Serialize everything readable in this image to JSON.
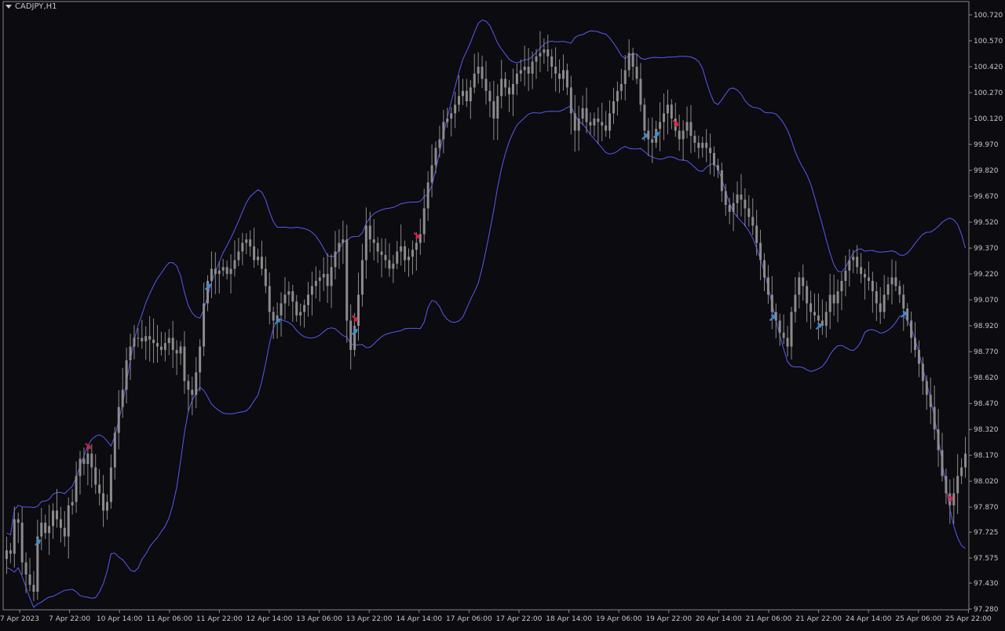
{
  "window": {
    "symbol": "CADJPY,H1"
  },
  "colors": {
    "background": "#0b0b10",
    "axis": "#8a8a8a",
    "text": "#c8c8c8",
    "candle": "#8c8c8c",
    "bands": "#5a5af0",
    "buy_arrow": "#3c8ccf",
    "sell_arrow": "#e01b3c"
  },
  "chart_data": {
    "type": "candlestick",
    "title": "CADJPY,H1",
    "ylim": [
      97.28,
      100.77
    ],
    "y_ticks": [
      "100.720",
      "100.570",
      "100.420",
      "100.270",
      "100.120",
      "99.970",
      "99.820",
      "99.670",
      "99.520",
      "99.370",
      "99.220",
      "99.070",
      "98.920",
      "98.770",
      "98.620",
      "98.470",
      "98.320",
      "98.170",
      "98.020",
      "97.870",
      "97.725",
      "97.575",
      "97.430",
      "97.280"
    ],
    "x_ticks": [
      "7 Apr 2023",
      "7 Apr 22:00",
      "10 Apr 14:00",
      "11 Apr 06:00",
      "11 Apr 22:00",
      "12 Apr 14:00",
      "13 Apr 06:00",
      "13 Apr 22:00",
      "14 Apr 14:00",
      "17 Apr 06:00",
      "17 Apr 22:00",
      "18 Apr 14:00",
      "19 Apr 06:00",
      "19 Apr 22:00",
      "20 Apr 14:00",
      "21 Apr 06:00",
      "21 Apr 22:00",
      "24 Apr 14:00",
      "25 Apr 06:00",
      "25 Apr 22:00"
    ],
    "grid": false,
    "close": [
      97.62,
      97.6,
      97.8,
      97.78,
      97.55,
      97.48,
      97.42,
      97.38,
      97.7,
      97.78,
      97.72,
      97.76,
      97.85,
      97.8,
      97.75,
      97.7,
      97.88,
      97.9,
      98.05,
      98.15,
      98.12,
      98.18,
      98.1,
      98.0,
      97.95,
      97.85,
      97.9,
      98.1,
      98.3,
      98.45,
      98.55,
      98.72,
      98.8,
      98.85,
      98.85,
      98.83,
      98.86,
      98.84,
      98.82,
      98.8,
      98.78,
      98.82,
      98.85,
      98.78,
      98.76,
      98.8,
      98.6,
      98.55,
      98.52,
      98.65,
      98.8,
      99.05,
      99.18,
      99.25,
      99.22,
      99.24,
      99.26,
      99.22,
      99.25,
      99.3,
      99.35,
      99.4,
      99.42,
      99.38,
      99.3,
      99.32,
      99.25,
      99.15,
      99.0,
      98.95,
      98.98,
      99.05,
      99.1,
      99.12,
      99.06,
      98.98,
      99.0,
      99.04,
      99.1,
      99.15,
      99.18,
      99.2,
      99.22,
      99.15,
      99.26,
      99.35,
      99.4,
      99.42,
      98.95,
      98.78,
      98.92,
      99.1,
      99.3,
      99.5,
      99.42,
      99.4,
      99.35,
      99.33,
      99.3,
      99.25,
      99.28,
      99.35,
      99.38,
      99.3,
      99.32,
      99.36,
      99.4,
      99.45,
      99.6,
      99.75,
      99.85,
      99.95,
      100.0,
      100.1,
      100.12,
      100.15,
      100.2,
      100.25,
      100.28,
      100.22,
      100.3,
      100.38,
      100.42,
      100.35,
      100.28,
      100.22,
      100.12,
      100.25,
      100.35,
      100.3,
      100.26,
      100.32,
      100.38,
      100.4,
      100.42,
      100.38,
      100.45,
      100.48,
      100.5,
      100.52,
      100.48,
      100.42,
      100.38,
      100.35,
      100.4,
      100.3,
      100.15,
      100.05,
      100.12,
      100.18,
      100.1,
      100.08,
      100.12,
      100.1,
      100.08,
      100.05,
      100.15,
      100.22,
      100.28,
      100.32,
      100.4,
      100.5,
      100.42,
      100.35,
      100.2,
      100.05,
      100.0,
      99.98,
      100.06,
      100.1,
      100.15,
      100.2,
      100.12,
      100.05,
      100.0,
      100.05,
      100.1,
      100.02,
      99.98,
      99.95,
      99.98,
      99.95,
      99.92,
      99.85,
      99.82,
      99.7,
      99.62,
      99.58,
      99.63,
      99.68,
      99.65,
      99.6,
      99.55,
      99.5,
      99.4,
      99.3,
      99.2,
      99.1,
      99.0,
      98.95,
      98.88,
      98.85,
      98.8,
      99.0,
      99.1,
      99.2,
      99.15,
      99.05,
      99.0,
      98.98,
      98.95,
      98.92,
      99.0,
      99.1,
      99.05,
      99.12,
      99.18,
      99.24,
      99.3,
      99.32,
      99.26,
      99.22,
      99.2,
      99.18,
      99.12,
      99.05,
      99.0,
      99.1,
      99.16,
      99.2,
      99.15,
      99.1,
      99.02,
      98.95,
      98.85,
      98.78,
      98.7,
      98.6,
      98.52,
      98.45,
      98.32,
      98.2,
      98.05,
      97.95,
      97.88,
      97.95,
      98.05,
      98.1,
      98.18
    ]
  },
  "signals": {
    "buy": [
      8,
      52,
      70,
      90,
      165,
      168,
      198,
      210,
      232,
      258,
      263
    ],
    "sell": [
      21,
      90,
      106,
      173,
      244
    ]
  }
}
